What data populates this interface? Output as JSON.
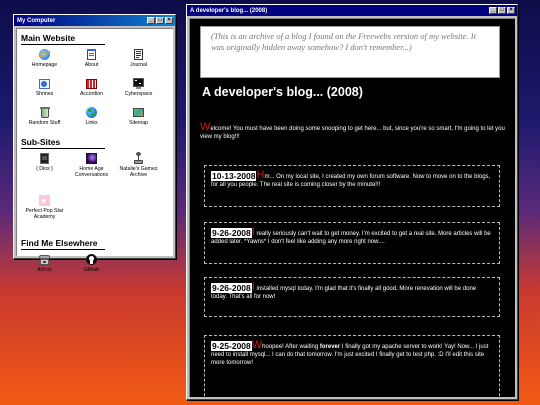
{
  "mycomputer": {
    "title": "My Computer",
    "sections": [
      {
        "title": "Main Website",
        "items": [
          {
            "label": "Homepage",
            "icon": "ie-globe-icon"
          },
          {
            "label": "About",
            "icon": "notepad-icon"
          },
          {
            "label": "Journal",
            "icon": "document-icon"
          },
          {
            "label": "Shrines",
            "icon": "shrine-folder-icon"
          },
          {
            "label": "Accordion",
            "icon": "accordion-icon"
          },
          {
            "label": "Cyberspace",
            "icon": "monitor-icon"
          },
          {
            "label": "Random Stuff",
            "icon": "recycle-bin-icon"
          },
          {
            "label": "Links",
            "icon": "globe-icon"
          },
          {
            "label": "Sitemap",
            "icon": "map-icon"
          }
        ]
      },
      {
        "title": "Sub-Sites",
        "items": [
          {
            "label": "{ Dios }",
            "icon": "dark-book-icon"
          },
          {
            "label": "Home Age Conversations",
            "icon": "purple-image-icon"
          },
          {
            "label": "Natalie's Gamez Archive",
            "icon": "joystick-icon"
          },
          {
            "label": "Perfect Pop Star Academy",
            "icon": "pink-heart-icon"
          }
        ]
      },
      {
        "title": "Find Me Elsewhere",
        "items": [
          {
            "label": "Itch.io",
            "icon": "itchio-icon"
          },
          {
            "label": "Github",
            "icon": "github-icon"
          }
        ]
      }
    ]
  },
  "blog": {
    "window_title": "A developer's blog... (2008)",
    "note": "(This is an archive of a blog I found on the Freewebs version of my website. It was originally hidden away somehow? I don't remember...)",
    "heading": "A developer's blog... (2008)",
    "intro_cap": "W",
    "intro": "elcome! You must have been doing some snooping to get here... but, since you're so smart, I'm going to let you view my blog!!!",
    "posts": [
      {
        "date": "10-13-2008",
        "cap": "H",
        "text": "m... On my local site, I created my own forum software. Now to move on to the blogs, for all you people. The real site is coming closer by the minute!!!"
      },
      {
        "date": "9-26-2008",
        "cap": "I",
        "text": " really seriously can't wait to get money. I'm excited to get a real site. More articles will be added later. *Yawns* I don't feel like adding any more right now...."
      },
      {
        "date": "9-26-2008",
        "cap": "I",
        "text": " installed mysql today. I'm glad that it's finally all good. More renevation will be done today. That's all for now!"
      },
      {
        "date": "9-25-2008",
        "cap": "W",
        "text_pre": "hoopee! After waiting ",
        "text_bold": "forever",
        "text_post": " I finally got my apache server to work! Yay! Now... I just need to install mysql... I can do that tomorrow. I'm just excited I finally get to test php. :D I'll edit this site more tomorrow!"
      }
    ]
  },
  "colors": {
    "titlebar": "#000080",
    "dropcap": "#d01818",
    "window_face": "#c0c0c0"
  }
}
